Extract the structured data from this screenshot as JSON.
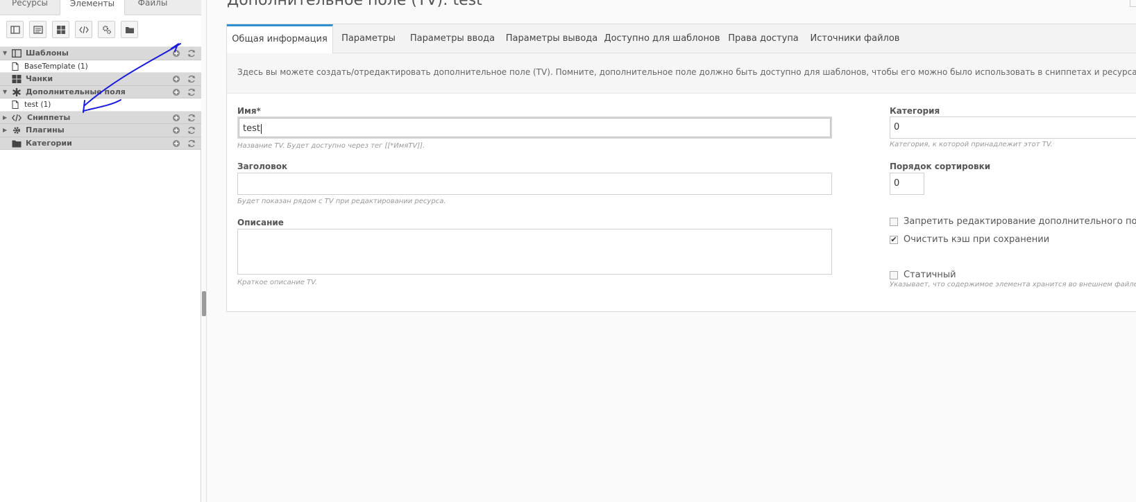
{
  "tree_tabs": [
    {
      "label": "Ресурсы",
      "active": false
    },
    {
      "label": "Элементы",
      "active": true
    },
    {
      "label": "Файлы",
      "active": false
    }
  ],
  "tree_toolbar": [
    {
      "icon": "template-icon"
    },
    {
      "icon": "tv-icon"
    },
    {
      "icon": "chunk-icon"
    },
    {
      "icon": "code-icon"
    },
    {
      "icon": "plugin-gears-icon"
    },
    {
      "icon": "folder-icon"
    }
  ],
  "tree": {
    "templates": {
      "label": "Шаблоны",
      "child": "BaseTemplate (1)"
    },
    "chunks": {
      "label": "Чанки"
    },
    "tvs": {
      "label": "Дополнительные поля",
      "child": "test (1)"
    },
    "snippets": {
      "label": "Сниппеты"
    },
    "plugins": {
      "label": "Плагины"
    },
    "categories": {
      "label": "Категории"
    }
  },
  "page_title": "Дополнительное поле (TV): test",
  "tabs": [
    "Общая информация",
    "Параметры",
    "Параметры ввода",
    "Параметры вывода",
    "Доступно для шаблонов",
    "Права доступа",
    "Источники файлов"
  ],
  "description": "Здесь вы можете создать/отредактировать дополнительное поле (TV). Помните, дополнительное поле должно быть доступно для шаблонов, чтобы его можно было использовать в сниппетах и ресурсах.",
  "form": {
    "name": {
      "label": "Имя*",
      "value": "test",
      "help": "Название TV. Будет доступно через тег [[*ИмяTV]]."
    },
    "caption": {
      "label": "Заголовок",
      "value": "",
      "help": "Будет показан рядом с TV при редактировании ресурса."
    },
    "description": {
      "label": "Описание",
      "value": "",
      "help": "Краткое описание TV."
    },
    "category": {
      "label": "Категория",
      "value": "0",
      "help": "Категория, к которой принадлежит этот TV."
    },
    "rank": {
      "label": "Порядок сортировки",
      "value": "0"
    },
    "locked": {
      "label": "Запретить редактирование дополнительного поля",
      "checked": false
    },
    "clear_cache": {
      "label": "Очистить кэш при сохранении",
      "checked": true
    },
    "static": {
      "label": "Статичный",
      "checked": false,
      "help": "Указывает, что содержимое элемента хранится во внешнем файле."
    }
  },
  "colors": {
    "tab_accent": "#2f8fcf",
    "annotation_stroke": "#1a1adc"
  }
}
